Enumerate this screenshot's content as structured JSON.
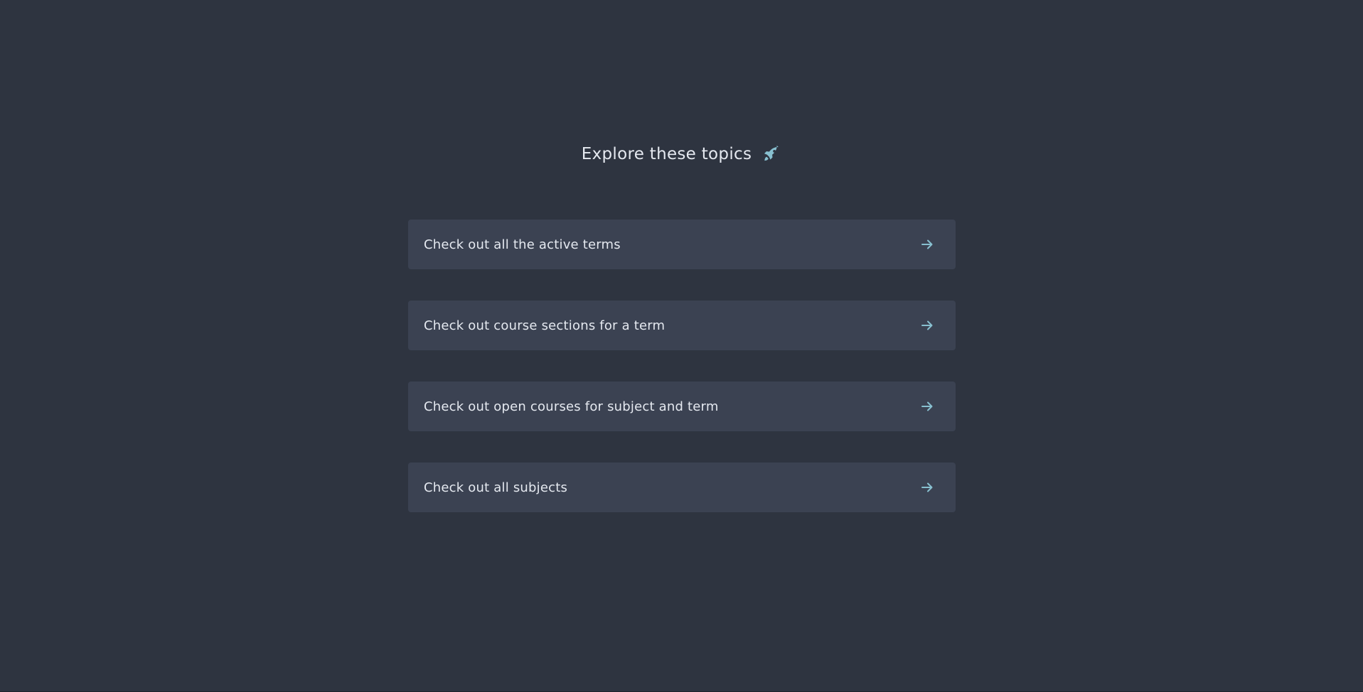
{
  "heading": {
    "title": "Explore these topics",
    "icon": "rocket-icon"
  },
  "topics": [
    {
      "label": "Check out all the active terms",
      "icon": "arrow-right-icon"
    },
    {
      "label": "Check out course sections for a term",
      "icon": "arrow-right-icon"
    },
    {
      "label": "Check out open courses for subject and term",
      "icon": "arrow-right-icon"
    },
    {
      "label": "Check out all subjects",
      "icon": "arrow-right-icon"
    }
  ],
  "colors": {
    "background": "#2e3440",
    "card": "#3b4252",
    "text": "#e5e9f0",
    "accent": "#88c0d0"
  }
}
